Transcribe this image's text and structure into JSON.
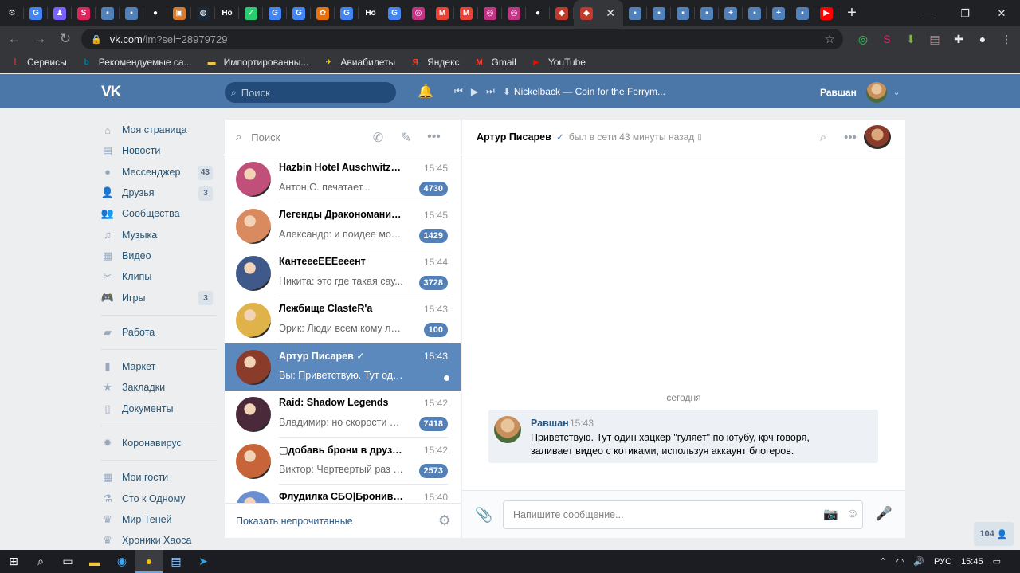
{
  "browser": {
    "tabs": [
      {
        "icon": "gear-icon",
        "glyph": "⚙",
        "color": "#202124"
      },
      {
        "icon": "google-icon",
        "glyph": "G",
        "color": "#4285f4"
      },
      {
        "icon": "profile-icon",
        "glyph": "♟",
        "color": "#7b61ff"
      },
      {
        "icon": "sc-icon",
        "glyph": "S",
        "color": "#e0245e"
      },
      {
        "icon": "chat-icon",
        "glyph": "▪",
        "color": "#5181b8"
      },
      {
        "icon": "chat-icon",
        "glyph": "▪",
        "color": "#5181b8"
      },
      {
        "icon": "github-icon",
        "glyph": "●",
        "color": "#202124"
      },
      {
        "icon": "store-icon",
        "glyph": "▣",
        "color": "#d97b2b"
      },
      {
        "icon": "steam-icon",
        "glyph": "◍",
        "color": "#1b2838"
      },
      {
        "icon": "text-icon",
        "glyph": "Hо",
        "color": "#202124"
      },
      {
        "icon": "check-icon",
        "glyph": "✓",
        "color": "#2ecc71"
      },
      {
        "icon": "google-icon",
        "glyph": "G",
        "color": "#4285f4"
      },
      {
        "icon": "google-icon",
        "glyph": "G",
        "color": "#4285f4"
      },
      {
        "icon": "flower-icon",
        "glyph": "✿",
        "color": "#e8710a"
      },
      {
        "icon": "google-icon",
        "glyph": "G",
        "color": "#4285f4"
      },
      {
        "icon": "text-icon",
        "glyph": "Hо",
        "color": "#202124"
      },
      {
        "icon": "google-icon",
        "glyph": "G",
        "color": "#4285f4"
      },
      {
        "icon": "instagram-icon",
        "glyph": "◎",
        "color": "#c13584"
      },
      {
        "icon": "gmail-icon",
        "glyph": "M",
        "color": "#ea4335"
      },
      {
        "icon": "gmail-icon",
        "glyph": "M",
        "color": "#ea4335"
      },
      {
        "icon": "instagram-icon",
        "glyph": "◎",
        "color": "#c13584"
      },
      {
        "icon": "instagram-icon",
        "glyph": "◎",
        "color": "#c13584"
      },
      {
        "icon": "github-icon",
        "glyph": "●",
        "color": "#202124"
      },
      {
        "icon": "game-icon",
        "glyph": "◆",
        "color": "#c0392b"
      }
    ],
    "active_tab_icon": "vk-icon",
    "tabs_after": [
      {
        "icon": "chat-icon",
        "glyph": "▪",
        "color": "#5181b8"
      },
      {
        "icon": "chat-icon",
        "glyph": "▪",
        "color": "#5181b8"
      },
      {
        "icon": "chat-icon",
        "glyph": "▪",
        "color": "#5181b8"
      },
      {
        "icon": "chat-icon",
        "glyph": "▪",
        "color": "#5181b8"
      },
      {
        "icon": "plus-icon",
        "glyph": "+",
        "color": "#5181b8"
      },
      {
        "icon": "chat-icon",
        "glyph": "▪",
        "color": "#5181b8"
      },
      {
        "icon": "plus-icon",
        "glyph": "+",
        "color": "#5181b8"
      },
      {
        "icon": "chat-icon",
        "glyph": "▪",
        "color": "#5181b8"
      },
      {
        "icon": "youtube-icon",
        "glyph": "▶",
        "color": "#ff0000"
      }
    ],
    "url_host": "vk.com",
    "url_path": "/im?sel=28979729",
    "bookmarks": [
      {
        "label": "Сервисы",
        "icon": "apps-icon",
        "color": "#ea4335",
        "glyph": "⁞"
      },
      {
        "label": "Рекомендуемые са...",
        "icon": "bing-icon",
        "color": "#00809d",
        "glyph": "b"
      },
      {
        "label": "Импортированны...",
        "icon": "folder-icon",
        "color": "#f4c542",
        "glyph": "▬"
      },
      {
        "label": "Авиабилеты",
        "icon": "plane-icon",
        "color": "#ffcc00",
        "glyph": "✈"
      },
      {
        "label": "Яндекс",
        "icon": "yandex-icon",
        "color": "#fc3f1d",
        "glyph": "Я"
      },
      {
        "label": "Gmail",
        "icon": "gmail-icon",
        "color": "#ea4335",
        "glyph": "M"
      },
      {
        "label": "YouTube",
        "icon": "youtube-icon",
        "color": "#ff0000",
        "glyph": "▶"
      }
    ]
  },
  "vk_header": {
    "logo": "VK",
    "search_placeholder": "Поиск",
    "track": "Nickelback — Coin for the Ferrym...",
    "user_name": "Равшан"
  },
  "left_menu": {
    "group1": [
      {
        "label": "Моя страница",
        "icon": "home-icon",
        "glyph": "⌂",
        "badge": ""
      },
      {
        "label": "Новости",
        "icon": "news-icon",
        "glyph": "▤",
        "badge": ""
      },
      {
        "label": "Мессенджер",
        "icon": "messages-icon",
        "glyph": "●",
        "badge": "43"
      },
      {
        "label": "Друзья",
        "icon": "friends-icon",
        "glyph": "👤",
        "badge": "3"
      },
      {
        "label": "Сообщества",
        "icon": "communities-icon",
        "glyph": "👥",
        "badge": ""
      },
      {
        "label": "Музыка",
        "icon": "music-icon",
        "glyph": "♫",
        "badge": ""
      },
      {
        "label": "Видео",
        "icon": "video-icon",
        "glyph": "▦",
        "badge": ""
      },
      {
        "label": "Клипы",
        "icon": "clips-icon",
        "glyph": "✂",
        "badge": ""
      },
      {
        "label": "Игры",
        "icon": "games-icon",
        "glyph": "🎮",
        "badge": "3"
      }
    ],
    "group2": [
      {
        "label": "Работа",
        "icon": "work-icon",
        "glyph": "▰",
        "badge": ""
      }
    ],
    "group3": [
      {
        "label": "Маркет",
        "icon": "market-icon",
        "glyph": "▮",
        "badge": ""
      },
      {
        "label": "Закладки",
        "icon": "bookmarks-icon",
        "glyph": "★",
        "badge": ""
      },
      {
        "label": "Документы",
        "icon": "documents-icon",
        "glyph": "▯",
        "badge": ""
      }
    ],
    "group4": [
      {
        "label": "Коронавирус",
        "icon": "virus-icon",
        "glyph": "✹",
        "badge": ""
      }
    ],
    "group5": [
      {
        "label": "Мои гости",
        "icon": "guests-icon",
        "glyph": "▦",
        "badge": ""
      },
      {
        "label": "Сто к Одному",
        "icon": "flask-icon",
        "glyph": "⚗",
        "badge": ""
      },
      {
        "label": "Мир Теней",
        "icon": "crown-icon",
        "glyph": "♛",
        "badge": ""
      },
      {
        "label": "Хроники Хаоса",
        "icon": "crown-icon",
        "glyph": "♛",
        "badge": ""
      }
    ]
  },
  "dialogs": {
    "search_placeholder": "Поиск",
    "items": [
      {
        "name": "Hazbin Hotel Auschwitz | ч...",
        "time": "15:45",
        "preview": "Антон С. печатает...",
        "badge": "4730",
        "avatar": "#c0507a",
        "active": false
      },
      {
        "name": "Легенды Дракономании I...",
        "time": "15:45",
        "preview": "Александр: и поидее мож...",
        "badge": "1429",
        "avatar": "#d98b5f",
        "active": false
      },
      {
        "name": "КантеееЕЕЕееент",
        "time": "15:44",
        "preview": "Никита: это где такая сау...",
        "badge": "3728",
        "avatar": "#3f5a8a",
        "active": false
      },
      {
        "name": "Лежбище ClasteR'a",
        "time": "15:43",
        "preview": "Эрик: Люди всем кому ле...",
        "badge": "100",
        "avatar": "#e0b34a",
        "active": false
      },
      {
        "name": "Артур Писарев ✓",
        "time": "15:43",
        "preview": "Вы: Приветствую. Тут один хацкер...",
        "badge": "",
        "avatar": "#8a3b2a",
        "active": true
      },
      {
        "name": "Raid: Shadow Legends",
        "time": "15:42",
        "preview": "Владимир: но скорости б ...",
        "badge": "7418",
        "avatar": "#4a2a3a",
        "active": false
      },
      {
        "name": "▢добавь брони в друзья ...",
        "time": "15:42",
        "preview": "Виктор: Чертвертый раз у...",
        "badge": "2573",
        "avatar": "#c8643a",
        "active": false
      },
      {
        "name": "Флудилка СБО|Брониви...",
        "time": "15:40",
        "preview": "",
        "badge": "",
        "avatar": "#6a8fd0",
        "active": false
      }
    ],
    "show_unread": "Показать непрочитанные"
  },
  "chat": {
    "peer_name": "Артур Писарев",
    "peer_status": "был в сети 43 минуты назад",
    "day_label": "сегодня",
    "message": {
      "author": "Равшан",
      "time": "15:43",
      "text_line1": "Приветствую. Тут один хацкер \"гуляет\" по ютубу, крч говоря,",
      "text_line2": "заливает видео с котиками, используя аккаунт блогеров."
    },
    "composer_placeholder": "Напишите сообщение..."
  },
  "online_count": "104",
  "taskbar": {
    "lang": "РУС",
    "time": "15:45"
  }
}
